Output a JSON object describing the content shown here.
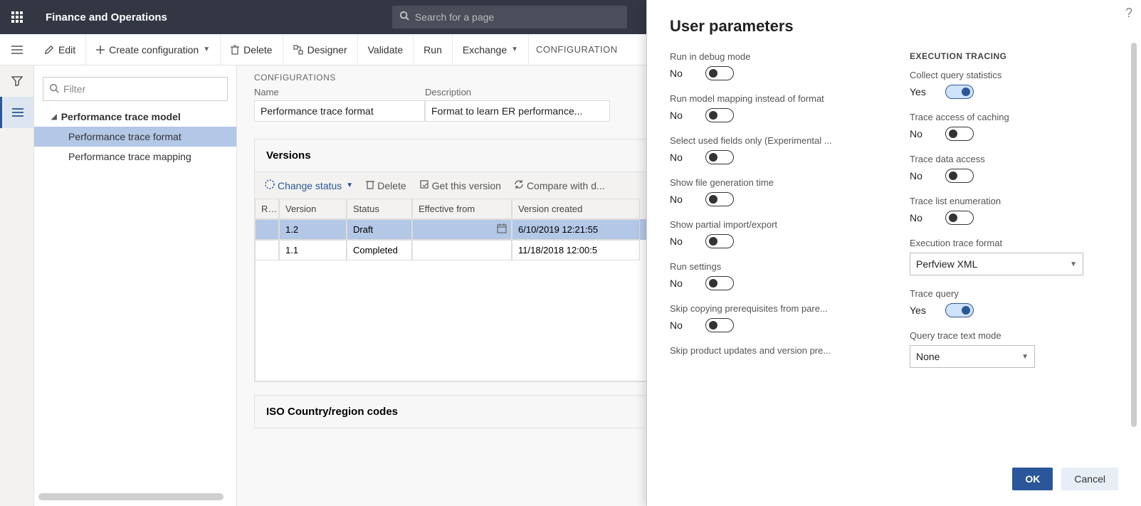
{
  "header": {
    "app_title": "Finance and Operations",
    "search_placeholder": "Search for a page"
  },
  "command_bar": {
    "edit": "Edit",
    "create_config": "Create configuration",
    "delete": "Delete",
    "designer": "Designer",
    "validate": "Validate",
    "run": "Run",
    "exchange": "Exchange",
    "breadcrumb": "CONFIGURATION"
  },
  "filter_placeholder": "Filter",
  "tree": {
    "root": "Performance trace model",
    "child1": "Performance trace format",
    "child2": "Performance trace mapping"
  },
  "configs": {
    "section": "CONFIGURATIONS",
    "name_hdr": "Name",
    "desc_hdr": "Description",
    "name": "Performance trace format",
    "desc": "Format to learn ER performance..."
  },
  "versions": {
    "title": "Versions",
    "change_status": "Change status",
    "delete": "Delete",
    "get_version": "Get this version",
    "compare": "Compare with d...",
    "cols": {
      "r": "R...",
      "ver": "Version",
      "stat": "Status",
      "eff": "Effective from",
      "created": "Version created"
    },
    "rows": [
      {
        "r": "",
        "ver": "1.2",
        "stat": "Draft",
        "eff": "",
        "created": "6/10/2019 12:21:55"
      },
      {
        "r": "",
        "ver": "1.1",
        "stat": "Completed",
        "eff": "",
        "created": "11/18/2018 12:00:5"
      }
    ]
  },
  "iso_title": "ISO Country/region codes",
  "flyout": {
    "title": "User parameters",
    "left": [
      {
        "label": "Run in debug mode",
        "val": "No",
        "on": false
      },
      {
        "label": "Run model mapping instead of format",
        "val": "No",
        "on": false
      },
      {
        "label": "Select used fields only (Experimental ...",
        "val": "No",
        "on": false
      },
      {
        "label": "Show file generation time",
        "val": "No",
        "on": false
      },
      {
        "label": "Show partial import/export",
        "val": "No",
        "on": false
      },
      {
        "label": "Run settings",
        "val": "No",
        "on": false
      },
      {
        "label": "Skip copying prerequisites from pare...",
        "val": "No",
        "on": false
      },
      {
        "label": "Skip product updates and version pre...",
        "val": "",
        "on": false
      }
    ],
    "right_title": "EXECUTION TRACING",
    "right": [
      {
        "label": "Collect query statistics",
        "val": "Yes",
        "on": true
      },
      {
        "label": "Trace access of caching",
        "val": "No",
        "on": false
      },
      {
        "label": "Trace data access",
        "val": "No",
        "on": false
      },
      {
        "label": "Trace list enumeration",
        "val": "No",
        "on": false
      }
    ],
    "exec_trace_fmt_label": "Execution trace format",
    "exec_trace_fmt_value": "Perfview XML",
    "trace_query": {
      "label": "Trace query",
      "val": "Yes",
      "on": true
    },
    "query_mode_label": "Query trace text mode",
    "query_mode_value": "None",
    "ok": "OK",
    "cancel": "Cancel"
  }
}
